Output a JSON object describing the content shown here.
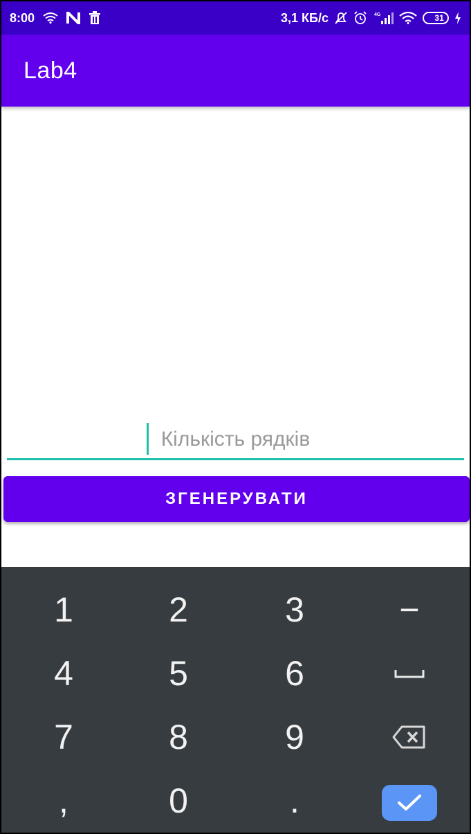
{
  "status_bar": {
    "time": "8:00",
    "speed": "3,1 КБ/с",
    "battery": "31",
    "network": "4G"
  },
  "app_bar": {
    "title": "Lab4"
  },
  "input": {
    "placeholder": "Кількість рядків",
    "value": ""
  },
  "button": {
    "label": "ЗГЕНЕРУВАТИ"
  },
  "keyboard": {
    "rows": [
      [
        "1",
        "2",
        "3",
        "−"
      ],
      [
        "4",
        "5",
        "6",
        ""
      ],
      [
        "7",
        "8",
        "9",
        ""
      ],
      [
        ",",
        "0",
        ".",
        ""
      ]
    ]
  },
  "colors": {
    "status_bar": "#3a00c8",
    "primary": "#6200ee",
    "accent": "#1fbfae",
    "keyboard_bg": "#373c40",
    "done_key": "#5b95f6"
  }
}
